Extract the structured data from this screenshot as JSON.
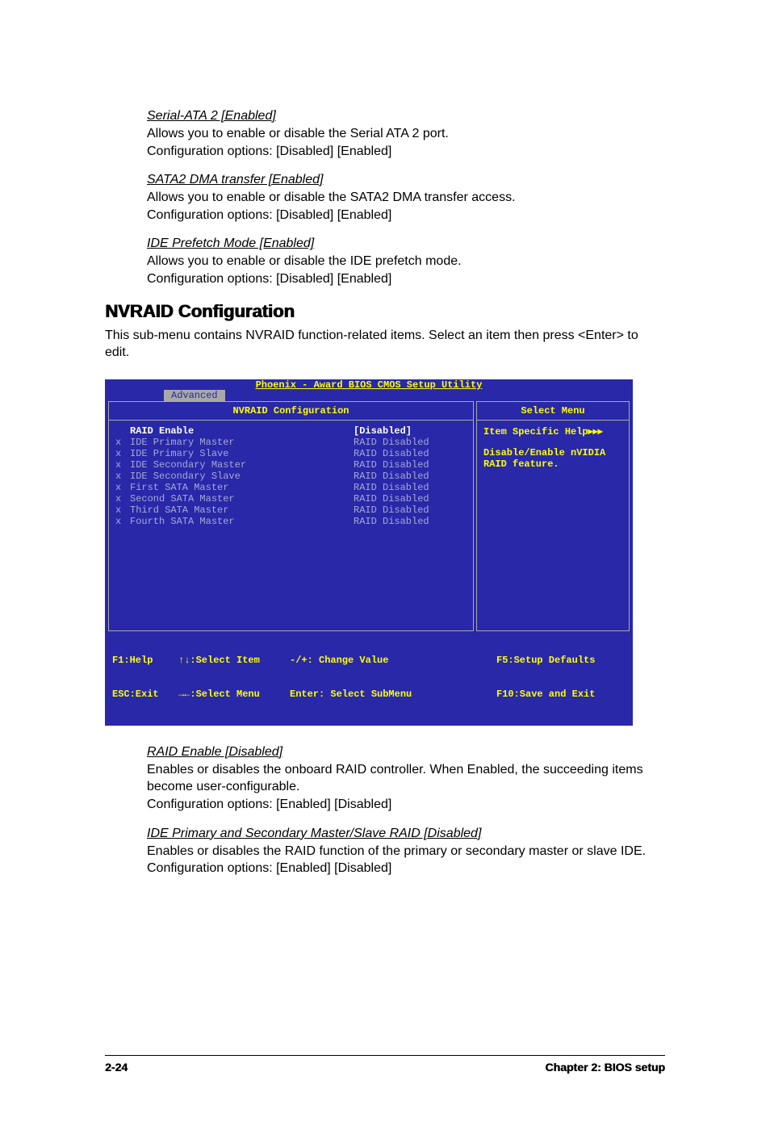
{
  "options": {
    "serial_ata2": {
      "title": "Serial-ATA 2 [Enabled]",
      "line1": "Allows you to enable or disable the Serial ATA 2 port.",
      "line2": "Configuration options: [Disabled] [Enabled]"
    },
    "sata2_dma": {
      "title": "SATA2 DMA transfer [Enabled]",
      "line1": "Allows you to enable or disable the SATA2 DMA transfer access.",
      "line2": "Configuration options: [Disabled] [Enabled]"
    },
    "ide_prefetch": {
      "title": "IDE Prefetch Mode [Enabled]",
      "line1": "Allows you to enable or disable the IDE prefetch mode.",
      "line2": "Configuration options: [Disabled] [Enabled]"
    }
  },
  "section": {
    "heading": "NVRAID Configuration",
    "desc": "This sub-menu contains NVRAID function-related items. Select an item then press <Enter> to edit."
  },
  "bios": {
    "title": "Phoenix - Award BIOS CMOS Setup Utility",
    "tab": "Advanced",
    "left_header": "NVRAID Configuration",
    "right_header": "Select Menu",
    "rows": [
      {
        "x": "",
        "label": "RAID Enable",
        "value": "[Disabled]",
        "active": true
      },
      {
        "x": "x",
        "label": "IDE Primary Master",
        "value": "RAID Disabled",
        "active": false
      },
      {
        "x": "x",
        "label": "IDE Primary Slave",
        "value": "RAID Disabled",
        "active": false
      },
      {
        "x": "x",
        "label": "IDE Secondary Master",
        "value": "RAID Disabled",
        "active": false
      },
      {
        "x": "x",
        "label": "IDE Secondary Slave",
        "value": "RAID Disabled",
        "active": false
      },
      {
        "x": "x",
        "label": "First SATA Master",
        "value": "RAID Disabled",
        "active": false
      },
      {
        "x": "x",
        "label": "Second SATA Master",
        "value": "RAID Disabled",
        "active": false
      },
      {
        "x": "x",
        "label": "Third SATA Master",
        "value": "RAID Disabled",
        "active": false
      },
      {
        "x": "x",
        "label": "Fourth SATA Master",
        "value": "RAID Disabled",
        "active": false
      }
    ],
    "help": {
      "title": "Item Specific Help▸▸▸",
      "line1": "Disable/Enable nVIDIA",
      "line2": "RAID feature."
    },
    "footer": {
      "r1c1": "F1:Help",
      "r1c2": "↑↓:Select Item",
      "r1c3": "-/+: Change Value",
      "r1c4": "F5:Setup Defaults",
      "r2c1": "ESC:Exit",
      "r2c2": "→←:Select Menu",
      "r2c3": "Enter: Select SubMenu",
      "r2c4": "F10:Save and Exit"
    }
  },
  "after_bios": {
    "raid_enable": {
      "title": "RAID Enable [Disabled]",
      "line1": "Enables or disables the onboard RAID controller. When Enabled, the succeeding items become user-configurable.",
      "line2": "Configuration options: [Enabled] [Disabled]"
    },
    "ide_primary_secondary": {
      "title": "IDE Primary and Secondary Master/Slave RAID [Disabled]",
      "line1": "Enables or disables the RAID function of the primary or secondary master or slave IDE. Configuration options: [Enabled] [Disabled]"
    }
  },
  "page_footer": {
    "left": "2-24",
    "right": "Chapter 2: BIOS setup"
  }
}
